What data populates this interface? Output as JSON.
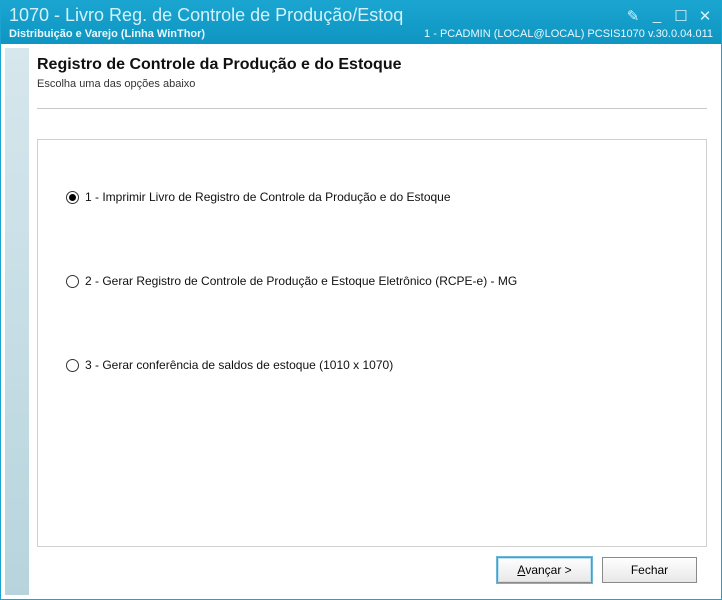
{
  "titlebar": {
    "title": "1070 - Livro Reg. de Controle de Produção/Estoq",
    "subtitle_left": "Distribuição e Varejo (Linha WinThor)",
    "subtitle_right": "1 - PCADMIN (LOCAL@LOCAL)   PCSIS1070   v.30.0.04.011"
  },
  "content": {
    "heading": "Registro de Controle da Produção e do Estoque",
    "subheading": "Escolha uma das opções abaixo"
  },
  "options": [
    {
      "label": "1 - Imprimir Livro de Registro de Controle da Produção e do Estoque",
      "selected": true
    },
    {
      "label": "2 - Gerar Registro de Controle de Produção e Estoque Eletrônico (RCPE-e) - MG",
      "selected": false
    },
    {
      "label": "3 - Gerar conferência de saldos de estoque (1010 x 1070)",
      "selected": false
    }
  ],
  "buttons": {
    "next_prefix": "A",
    "next_rest": "vançar >",
    "close": "Fechar"
  }
}
